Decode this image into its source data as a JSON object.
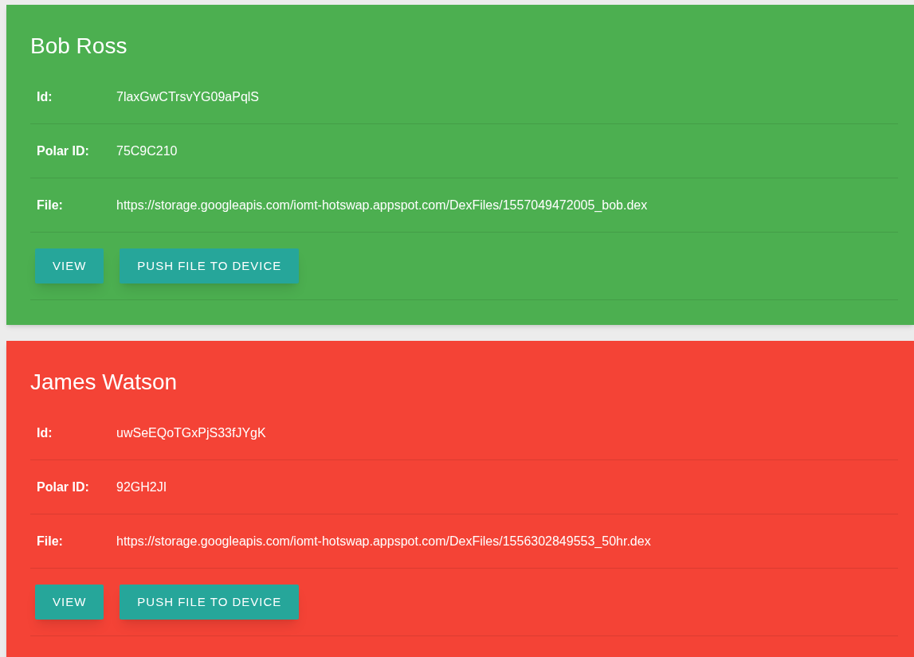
{
  "cards": [
    {
      "name": "Bob Ross",
      "color": "#4caf50",
      "fields": [
        {
          "label": "Id:",
          "value": "7laxGwCTrsvYG09aPqlS"
        },
        {
          "label": "Polar ID:",
          "value": "75C9C210"
        },
        {
          "label": "File:",
          "value": "https://storage.googleapis.com/iomt-hotswap.appspot.com/DexFiles/1557049472005_bob.dex"
        }
      ],
      "buttons": [
        "VIEW",
        "PUSH FILE TO DEVICE"
      ]
    },
    {
      "name": "James Watson",
      "color": "#f44336",
      "fields": [
        {
          "label": "Id:",
          "value": "uwSeEQoTGxPjS33fJYgK"
        },
        {
          "label": "Polar ID:",
          "value": "92GH2JI"
        },
        {
          "label": "File:",
          "value": "https://storage.googleapis.com/iomt-hotswap.appspot.com/DexFiles/1556302849553_50hr.dex"
        }
      ],
      "buttons": [
        "VIEW",
        "PUSH FILE TO DEVICE"
      ]
    }
  ]
}
